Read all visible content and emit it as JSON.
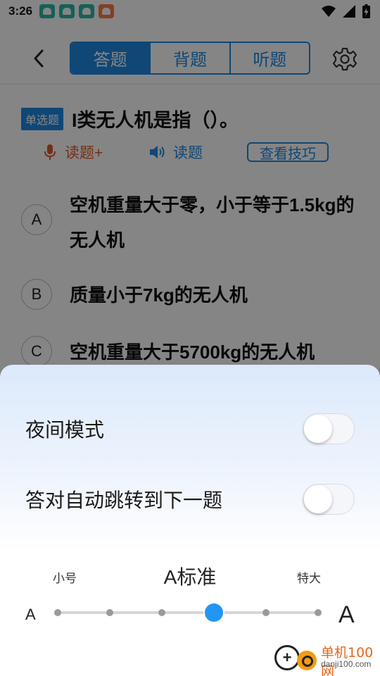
{
  "status_bar": {
    "time": "3:26",
    "notification_icons": [
      "app-icon-teal",
      "app-icon-teal",
      "app-icon-teal",
      "app-icon-orange-heart"
    ],
    "system_icons": [
      "wifi-icon",
      "signal-icon",
      "battery-charging-icon"
    ]
  },
  "header": {
    "tabs": [
      {
        "label": "答题",
        "active": true
      },
      {
        "label": "背题",
        "active": false
      },
      {
        "label": "听题",
        "active": false
      }
    ],
    "accent": "#1e88e5"
  },
  "question": {
    "type_badge": "单选题",
    "text": "I类无人机是指（）。",
    "tools": {
      "read_plus": "读题+",
      "read": "读题",
      "tips": "查看技巧"
    },
    "options": [
      {
        "letter": "A",
        "text": "空机重量大于零，小于等于1.5kg的无人机"
      },
      {
        "letter": "B",
        "text": "质量小于7kg的无人机"
      },
      {
        "letter": "C",
        "text": "空机重量大于5700kg的无人机"
      }
    ]
  },
  "settings_sheet": {
    "night_mode": {
      "label": "夜间模式",
      "on": false
    },
    "auto_next": {
      "label": "答对自动跳转到下一题",
      "on": false
    },
    "font_size": {
      "min_label": "小号",
      "max_label": "特大",
      "current_label": "A标准",
      "small_glyph": "A",
      "large_glyph": "A",
      "steps": 6,
      "selected_index": 3
    }
  },
  "watermark": {
    "logo_glyph": "+",
    "title": "单机100网",
    "url": "danji100.com"
  }
}
